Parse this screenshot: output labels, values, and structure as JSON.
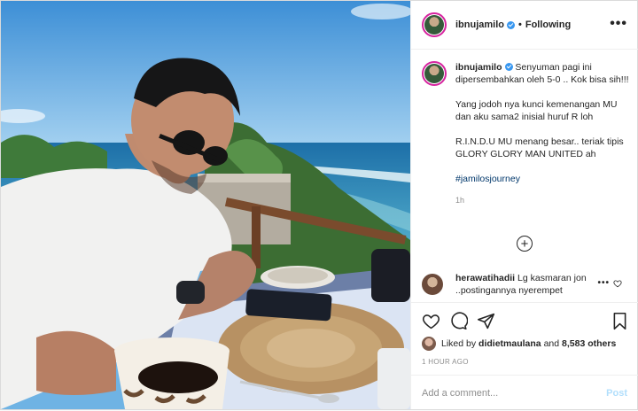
{
  "post": {
    "username": "ibnujamilo",
    "verified": true,
    "follow_status": "Following",
    "more_label": "•••",
    "caption": {
      "username": "ibnujamilo",
      "line1": "Senyuman pagi ini dipersembahkan oleh 5-0 .. Kok bisa sih!!!",
      "line2": "Yang jodoh nya kunci kemenangan MU dan aku sama2 inisial huruf R loh",
      "line3": "R.I.N.D.U MU menang besar.. teriak tipis GLORY GLORY MAN UNITED ah",
      "hashtag": "#jamilosjourney",
      "time": "1h"
    },
    "load_more": "+",
    "comment": {
      "username": "herawatihadii",
      "text": "Lg kasmaran jon",
      "text_cont": "..postingannya nyerempet",
      "dots": "•••"
    },
    "likes": {
      "prefix": "Liked by",
      "user": "didietmaulana",
      "middle": "and",
      "count": "8,583 others"
    },
    "ago": "1 HOUR AGO",
    "comment_input": {
      "placeholder": "Add a comment..."
    },
    "post_button": "Post"
  },
  "colors": {
    "sky": "#6fb3e4",
    "sea": "#2f86b6",
    "link": "#00376b",
    "post_disabled": "#b2dffc",
    "verified": "#3897f0"
  }
}
